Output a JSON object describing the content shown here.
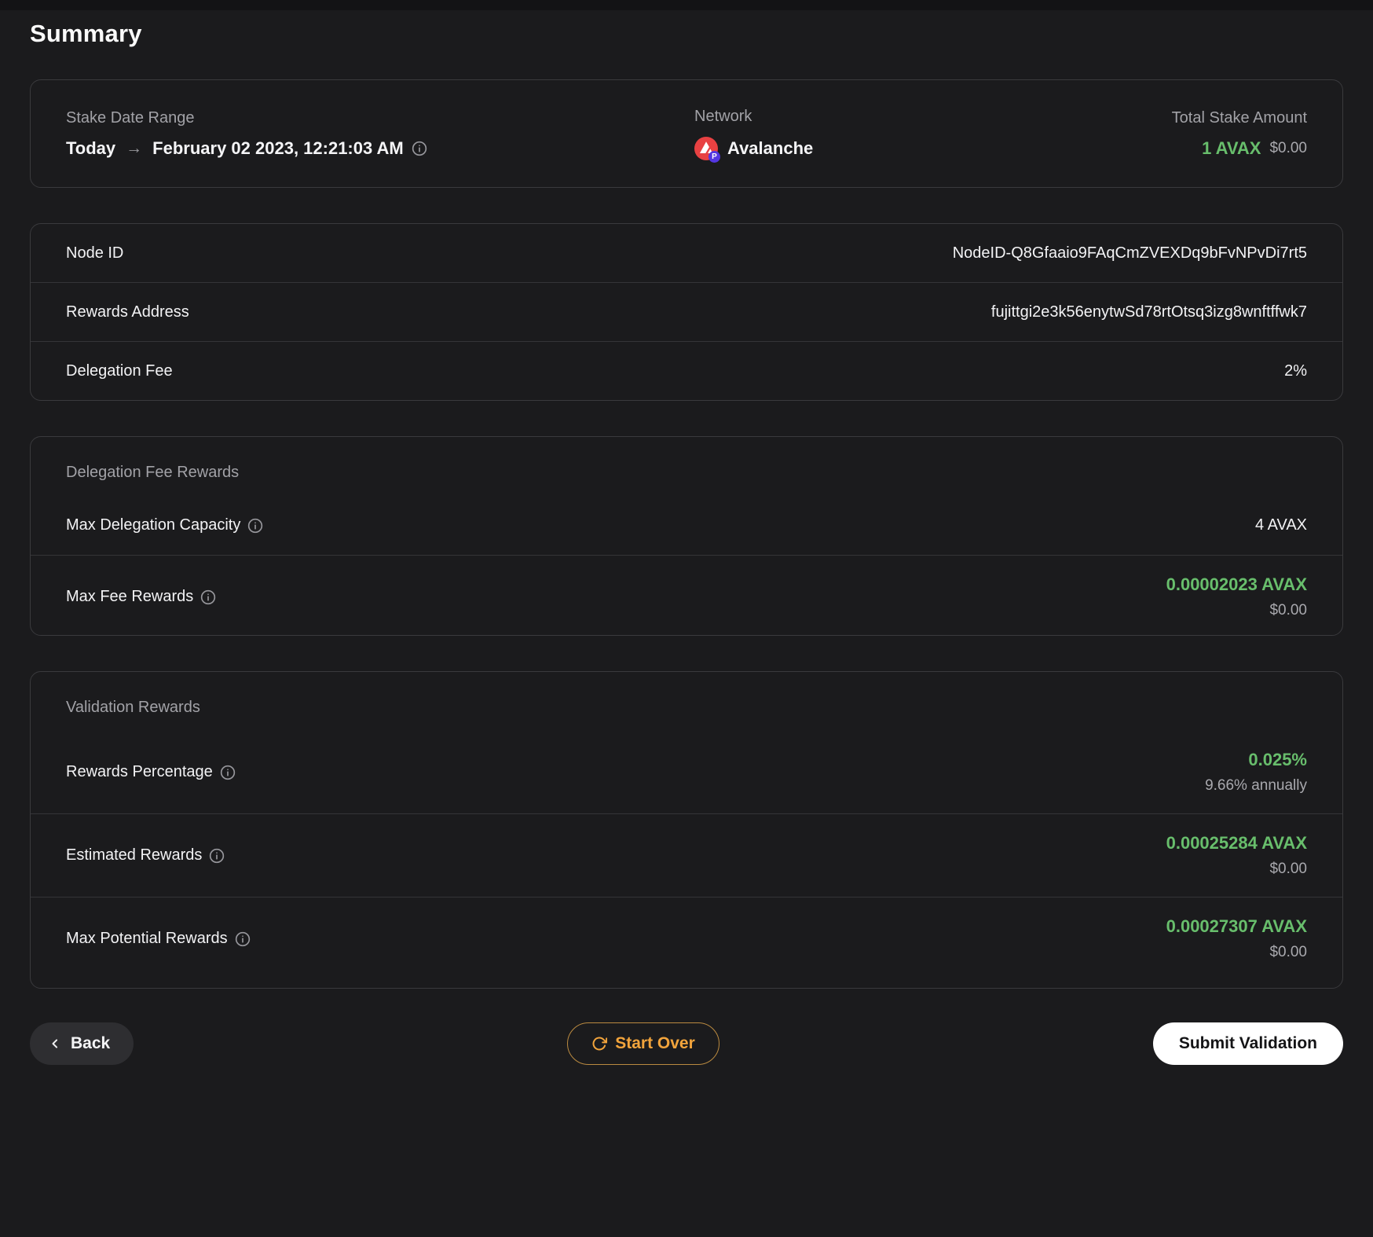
{
  "title": "Summary",
  "overview": {
    "stake_date_range": {
      "label": "Stake Date Range",
      "from": "Today",
      "arrow": "→",
      "to": "February 02 2023, 12:21:03 AM"
    },
    "network": {
      "label": "Network",
      "value": "Avalanche"
    },
    "total_stake": {
      "label": "Total Stake Amount",
      "amount": "1 AVAX",
      "fiat": "$0.00"
    }
  },
  "details": {
    "rows": [
      {
        "label": "Node ID",
        "value": "NodeID-Q8Gfaaio9FAqCmZVEXDq9bFvNPvDi7rt5"
      },
      {
        "label": "Rewards Address",
        "value": "fujittgi2e3k56enytwSd78rtOtsq3izg8wnftffwk7"
      },
      {
        "label": "Delegation Fee",
        "value": "2%"
      }
    ]
  },
  "delegation_fee_rewards": {
    "header": "Delegation Fee Rewards",
    "capacity": {
      "label": "Max Delegation Capacity",
      "value": "4 AVAX"
    },
    "max_fee": {
      "label": "Max Fee Rewards",
      "value": "0.00002023 AVAX",
      "fiat": "$0.00"
    }
  },
  "validation_rewards": {
    "header": "Validation Rewards",
    "percentage": {
      "label": "Rewards Percentage",
      "value": "0.025%",
      "sub": "9.66% annually"
    },
    "estimated": {
      "label": "Estimated Rewards",
      "value": "0.00025284 AVAX",
      "fiat": "$0.00"
    },
    "max_potential": {
      "label": "Max Potential Rewards",
      "value": "0.00027307 AVAX",
      "fiat": "$0.00"
    }
  },
  "footer": {
    "back_label": "Back",
    "start_over_label": "Start Over",
    "submit_label": "Submit Validation"
  },
  "icons": {
    "p_badge": "P"
  },
  "colors": {
    "accent_green": "#68BE6C",
    "accent_orange": "#F2A43C",
    "avalanche_red": "#E84142",
    "badge_purple": "#5336E2",
    "background": "#1B1B1D"
  }
}
